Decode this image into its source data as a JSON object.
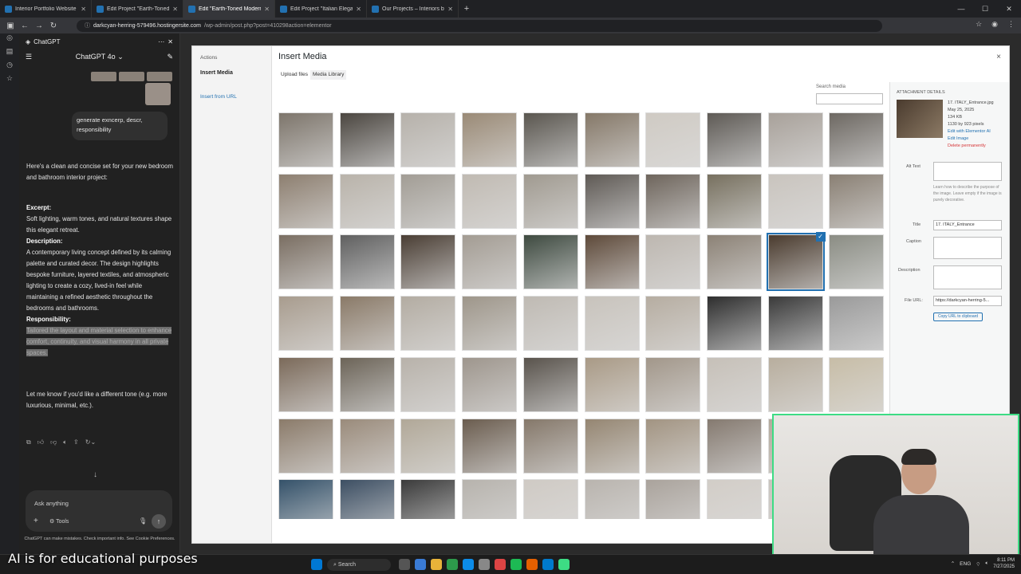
{
  "browser": {
    "tabs": [
      {
        "label": "Interior Portfolio Website",
        "active": false
      },
      {
        "label": "Edit Project \"Earth-Toned Mod...",
        "active": false
      },
      {
        "label": "Edit \"Earth-Toned Modern Sop...",
        "active": true
      },
      {
        "label": "Edit Project \"Italian Elegance in...",
        "active": false
      },
      {
        "label": "Our Projects – Interiors by Gura...",
        "active": false
      }
    ],
    "url_host": "darkcyan-herring-579496.hostingersite.com",
    "url_path": "/wp-admin/post.php?post=410298action=elementor"
  },
  "chatgpt": {
    "title": "ChatGPT",
    "model": "ChatGPT 4o",
    "user_message": "generate exncerp, descr, responsibility",
    "intro": "Here's a clean and concise set for your new bedroom and bathroom interior project:",
    "excerpt_heading": "Excerpt:",
    "excerpt": "Soft lighting, warm tones, and natural textures shape this elegant retreat.",
    "description_heading": "Description:",
    "description": "A contemporary living concept defined by its calming palette and curated decor. The design highlights bespoke furniture, layered textiles, and atmospheric lighting to create a cozy, lived-in feel while maintaining a refined aesthetic throughout the bedrooms and bathrooms.",
    "responsibility_heading": "Responsibility:",
    "responsibility": "Tailored the layout and material selection to enhance comfort, continuity, and visual harmony in all private spaces.",
    "closing": "Let me know if you'd like a different tone (e.g. more luxurious, minimal, etc.).",
    "composer_placeholder": "Ask anything",
    "tools_label": "Tools",
    "disclaimer": "ChatGPT can make mistakes. Check important info. See Cookie Preferences."
  },
  "media_modal": {
    "actions_label": "Actions",
    "menu_insert": "Insert Media",
    "menu_from_url": "Insert from URL",
    "title": "Insert Media",
    "tab_upload": "Upload files",
    "tab_library": "Media Library",
    "search_label": "Search media",
    "close": "×",
    "selected_index": 28,
    "attachment": {
      "heading": "ATTACHMENT DETAILS",
      "filename": "17. ITALY_Entrance.jpg",
      "date": "May 25, 2025",
      "size": "134 KB",
      "dimensions": "1130 by 923 pixels",
      "edit_link": "Edit with Elementor AI",
      "edit_image": "Edit Image",
      "delete": "Delete permanently",
      "alt_label": "Alt Text",
      "alt_help": "Learn how to describe the purpose of the image. Leave empty if the image is purely decorative.",
      "title_label": "Title",
      "title_value": "17. ITALY_Entrance",
      "caption_label": "Caption",
      "description_label": "Description",
      "file_url_label": "File URL:",
      "file_url_value": "https://darkcyan-herring-5...",
      "copy_label": "Copy URL to clipboard"
    },
    "thumb_colors": [
      "#7d756b",
      "#4b4640",
      "#b6b1aa",
      "#9a8a76",
      "#5a564f",
      "#857868",
      "#cfcac3",
      "#5e5a55",
      "#a8a19a",
      "#6d6862",
      "#8d7f70",
      "#b9b3aa",
      "#a29d95",
      "#c0bab2",
      "#a09a90",
      "#5f5a55",
      "#6e655c",
      "#77705f",
      "#c9c4be",
      "#8a8074",
      "#7a6e62",
      "#606060",
      "#4a3e34",
      "#a39c93",
      "#3e4a40",
      "#5e4a3a",
      "#bdb7b0",
      "#8c8276",
      "#4a3b2e",
      "#8b8d84",
      "#a89c8e",
      "#8a7a68",
      "#b3aca2",
      "#9e968a",
      "#bfbab3",
      "#c8c3bc",
      "#b6ada1",
      "#2e2e2e",
      "#3a3a3a",
      "#9a9a9a",
      "#7b6a5a",
      "#6c6458",
      "#b8b2aa",
      "#9e968d",
      "#59534c",
      "#a99a86",
      "#a2978a",
      "#c6c0b8",
      "#b8ae9e",
      "#c7bda7",
      "#8b7b6a",
      "#9a8b7b",
      "#b1a898",
      "#6b5d4f",
      "#85786a",
      "#958672",
      "#a29482",
      "#857a70",
      "#b4aa9c",
      "#c0b6a8",
      "#35526a",
      "#3d4f63",
      "#3b3b3b",
      "#b7b3ad",
      "#cfcac4",
      "#b9b4ae",
      "#aaa39c",
      "#d2cdc7",
      "#c9c4be",
      "#ddd9d3"
    ]
  },
  "taskbar": {
    "search": "Search",
    "lang": "ENG",
    "time": "8:11 PM",
    "date": "7/27/2025"
  },
  "caption": "AI is for educational purposes"
}
